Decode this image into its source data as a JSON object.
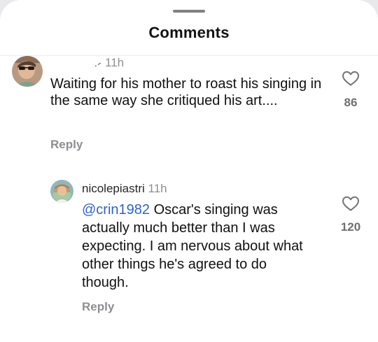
{
  "header": {
    "title": "Comments"
  },
  "comments": [
    {
      "username_partial": ".⹝",
      "time": "11h",
      "text": "Waiting for his mother to roast his singing in the same way she critiqued his art....",
      "reply_label": "Reply",
      "like_count": "86",
      "like_icon": "heart-outline-icon"
    },
    {
      "username": "nicolepiastri",
      "time": "11h",
      "mention": "@crin1982",
      "text": " Oscar's singing was actually much better than I was expecting. I am nervous about what other things he's agreed to do though.",
      "reply_label": "Reply",
      "like_count": "120",
      "like_icon": "heart-outline-icon"
    }
  ],
  "colors": {
    "mention": "#2f62c9",
    "meta": "#8e8e93",
    "text": "#111111"
  }
}
